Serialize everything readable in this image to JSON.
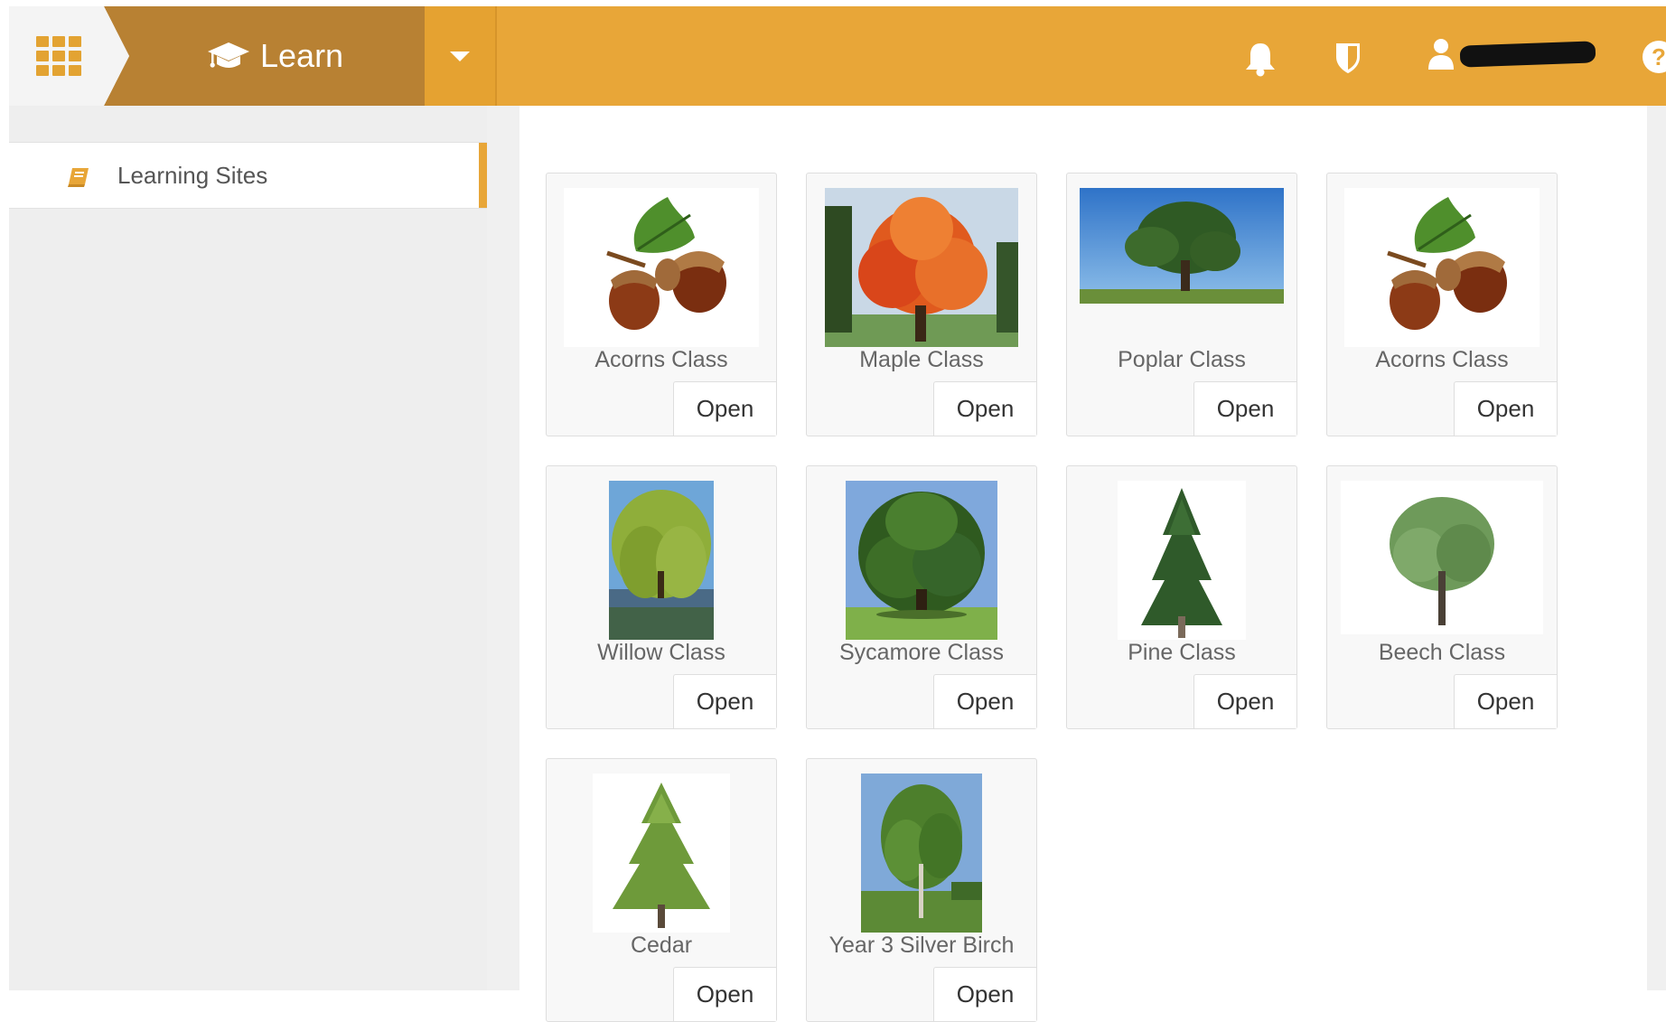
{
  "header": {
    "app_label": "Learn",
    "colors": {
      "bar": "#e8a638",
      "learn_segment": "#b88133",
      "accent": "#e8a638"
    },
    "icons": [
      "apps-grid-icon",
      "graduation-cap-icon",
      "chevron-down-icon",
      "bell-icon",
      "shield-icon",
      "user-icon",
      "help-icon"
    ]
  },
  "sidebar": {
    "items": [
      {
        "label": "Learning Sites",
        "icon": "book-icon",
        "active": true
      }
    ]
  },
  "tiles": [
    {
      "name": "Acorns Class",
      "button": "Open",
      "image": "acorns-image"
    },
    {
      "name": "Maple Class",
      "button": "Open",
      "image": "maple-tree-image"
    },
    {
      "name": "Poplar Class",
      "button": "Open",
      "image": "poplar-tree-image"
    },
    {
      "name": "Acorns Class",
      "button": "Open",
      "image": "acorns-image"
    },
    {
      "name": "Willow Class",
      "button": "Open",
      "image": "willow-tree-image"
    },
    {
      "name": "Sycamore Class",
      "button": "Open",
      "image": "sycamore-tree-image"
    },
    {
      "name": "Pine Class",
      "button": "Open",
      "image": "pine-tree-image"
    },
    {
      "name": "Beech Class",
      "button": "Open",
      "image": "beech-tree-image"
    },
    {
      "name": "Cedar",
      "button": "Open",
      "image": "cedar-tree-image"
    },
    {
      "name": "Year 3 Silver Birch",
      "button": "Open",
      "image": "silver-birch-tree-image"
    }
  ]
}
